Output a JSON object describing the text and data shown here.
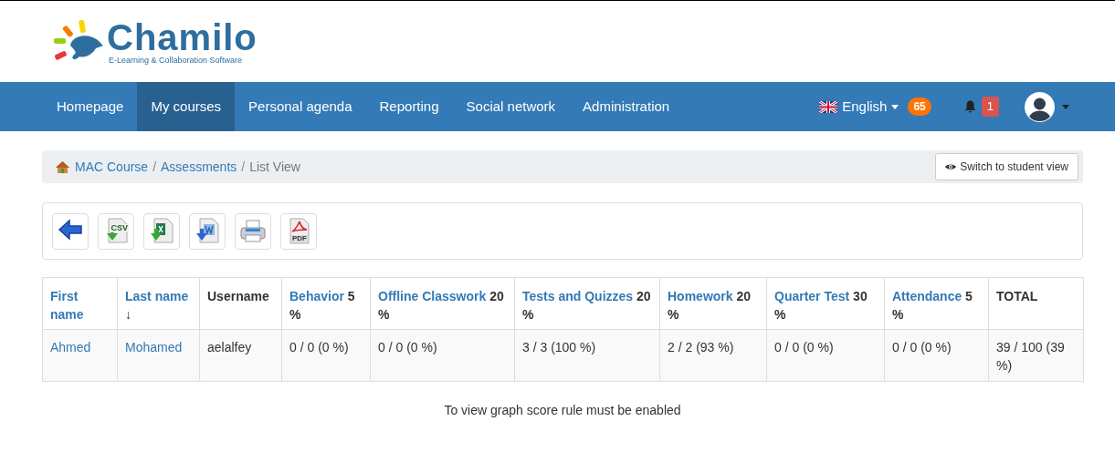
{
  "logo": {
    "name": "Chamilo",
    "tagline": "E-Learning & Collaboration Software"
  },
  "nav": [
    {
      "label": "Homepage",
      "selected": false
    },
    {
      "label": "My courses",
      "selected": true
    },
    {
      "label": "Personal agenda",
      "selected": false
    },
    {
      "label": "Reporting",
      "selected": false
    },
    {
      "label": "Social network",
      "selected": false
    },
    {
      "label": "Administration",
      "selected": false
    }
  ],
  "language": {
    "label": "English",
    "badge": "65"
  },
  "notifications": {
    "count": "1"
  },
  "breadcrumb": [
    {
      "label": "MAC Course",
      "kind": "link"
    },
    {
      "label": "Assessments",
      "kind": "link"
    },
    {
      "label": "List View",
      "kind": "current"
    }
  ],
  "breadcrumb_separator": "/",
  "switch_button": "Switch to student view",
  "toolbar": [
    {
      "kind": "back"
    },
    {
      "kind": "csv",
      "label": "CSV"
    },
    {
      "kind": "excel"
    },
    {
      "kind": "word"
    },
    {
      "kind": "print"
    },
    {
      "kind": "pdf",
      "label": "PDF"
    }
  ],
  "table": {
    "columns": [
      {
        "label": "First name",
        "kind": "link"
      },
      {
        "label": "Last name",
        "kind": "link",
        "sort": "↓"
      },
      {
        "label": "Username",
        "kind": "plain"
      },
      {
        "label": "Behavior",
        "kind": "link",
        "weight": "5 %"
      },
      {
        "label": "Offline Classwork",
        "kind": "link",
        "weight": "20 %"
      },
      {
        "label": "Tests and Quizzes",
        "kind": "link",
        "weight": "20 %"
      },
      {
        "label": "Homework",
        "kind": "link",
        "weight": "20 %"
      },
      {
        "label": "Quarter Test",
        "kind": "link",
        "weight": "30 %"
      },
      {
        "label": "Attendance",
        "kind": "link",
        "weight": "5 %"
      },
      {
        "label": "TOTAL",
        "kind": "plain"
      }
    ],
    "rows": [
      [
        {
          "text": "Ahmed",
          "kind": "link"
        },
        {
          "text": "Mohamed",
          "kind": "link"
        },
        {
          "text": "aelalfey",
          "kind": "text"
        },
        {
          "text": "0 / 0 (0 %)",
          "kind": "text"
        },
        {
          "text": "0 / 0 (0 %)",
          "kind": "text"
        },
        {
          "text": "3 / 3 (100 %)",
          "kind": "text"
        },
        {
          "text": "2 / 2 (93 %)",
          "kind": "text"
        },
        {
          "text": "0 / 0 (0 %)",
          "kind": "text"
        },
        {
          "text": "0 / 0 (0 %)",
          "kind": "text"
        },
        {
          "text": "39 / 100 (39 %)",
          "kind": "text"
        }
      ]
    ]
  },
  "message": "To view graph score rule must be enabled"
}
